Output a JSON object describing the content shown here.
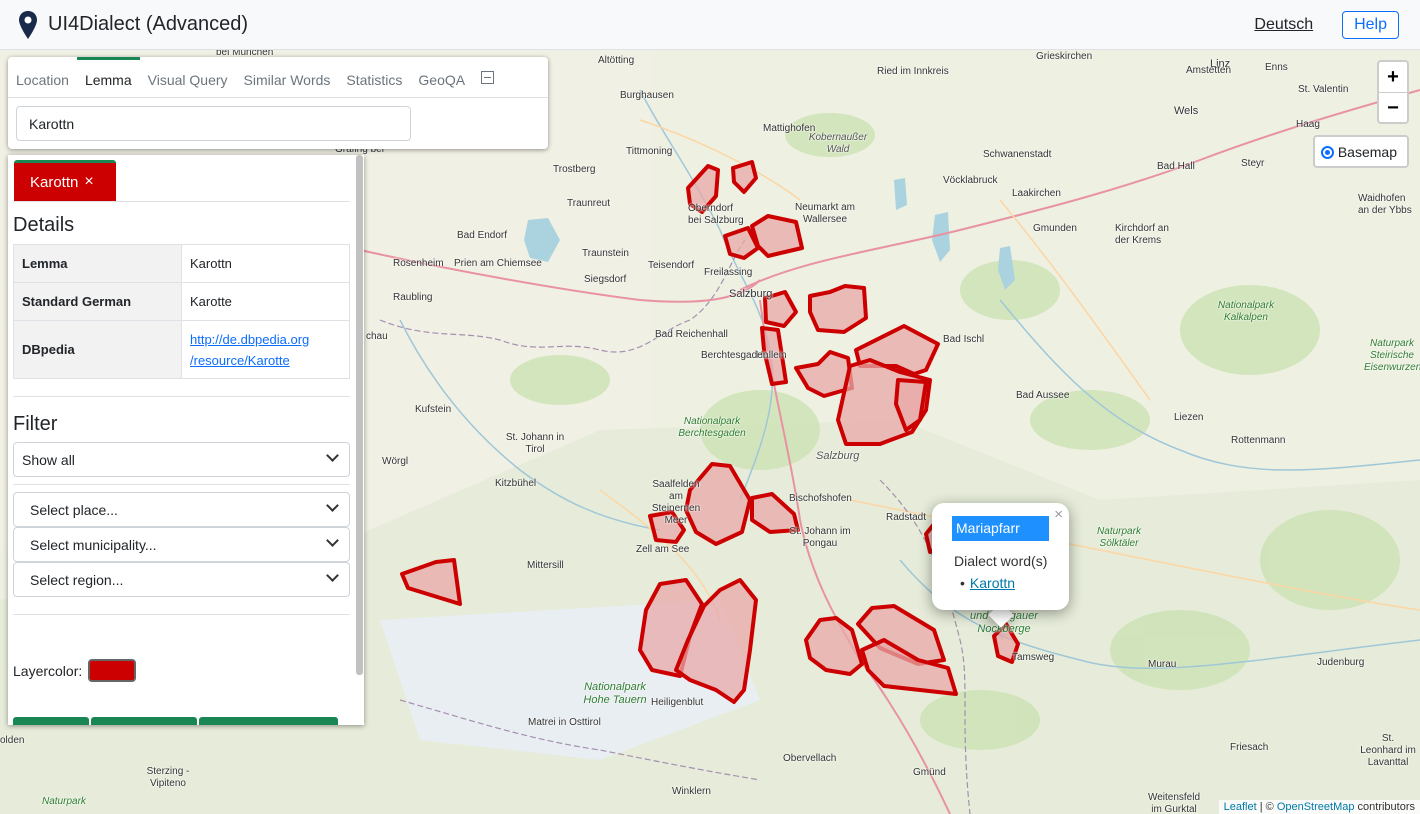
{
  "app": {
    "title": "UI4Dialect (Advanced)"
  },
  "nav": {
    "language_link": "Deutsch",
    "help_button": "Help"
  },
  "tabs": [
    {
      "label": "Location",
      "active": false
    },
    {
      "label": "Lemma",
      "active": true
    },
    {
      "label": "Visual Query",
      "active": false
    },
    {
      "label": "Similar Words",
      "active": false
    },
    {
      "label": "Statistics",
      "active": false
    },
    {
      "label": "GeoQA",
      "active": false
    }
  ],
  "search": {
    "value": "Karottn"
  },
  "sidebar": {
    "chip_label": "Karottn",
    "chip_close": "×",
    "details_title": "Details",
    "details": [
      {
        "key": "Lemma",
        "value": "Karottn"
      },
      {
        "key": "Standard German",
        "value": "Karotte"
      },
      {
        "key": "DBpedia",
        "link_line1": "http://de.dbpedia.org",
        "link_line2": "/resource/Karotte"
      }
    ],
    "filter_title": "Filter",
    "filter_select": "Show all",
    "place_select": "Select place...",
    "municipality_select": "Select municipality...",
    "region_select": "Select region...",
    "layercolor_label": "Layercolor:",
    "layercolor": "#cc0000"
  },
  "map_controls": {
    "zoom_in": "+",
    "zoom_out": "−",
    "basemap_label": "Basemap",
    "attribution_leaflet": "Leaflet",
    "attribution_sep": " | © ",
    "attribution_osm": "OpenStreetMap",
    "attribution_tail": " contributors"
  },
  "popup": {
    "title": "Mariapfarr",
    "close": "×",
    "subtitle": "Dialect word(s)",
    "bullet": "•",
    "word": "Karottn"
  },
  "map_labels": [
    "bei München",
    "Altötting",
    "Grieskirchen",
    "Ried im Innkreis",
    "Linz",
    "Amstetten",
    "Enns",
    "St. Valentin",
    "Burghausen",
    "Mattighofen",
    "Kobernaußer Wald",
    "Wels",
    "Haag",
    "Tittmoning",
    "Schwanenstadt",
    "Bad Hall",
    "Steyr",
    "Traunreut",
    "Trostberg",
    "Vöcklabruck",
    "Laakirchen",
    "Waidhofen an der Ybbs",
    "Oberndorf bei Salzburg",
    "Neumarkt am Wallersee",
    "Gmunden",
    "Kirchdorf an der Krems",
    "Bad Endorf",
    "Traunstein",
    "Teisendorf",
    "Rosenheim",
    "Prien am Chiemsee",
    "Siegsdorf",
    "Freilassing",
    "Raubling",
    "Salzburg",
    "Nationalpark Kalkalpen",
    "Bad Reichenhall",
    "Bad Ischl",
    "Hallein",
    "Naturpark Steirische Eisenwurzen",
    "Berchtesgaden",
    "Bad Aussee",
    "Kufstein",
    "Nationalpark Berchtesgaden",
    "Liezen",
    "St. Johann in Tirol",
    "Rottenmann",
    "Wörgl",
    "Kitzbühel",
    "Saalfelden am Steinernen Meer",
    "Bischofshofen",
    "Radstadt",
    "St. Johann im Pongau",
    "Zell am See",
    "Naturpark Sölktäler",
    "Mittersill",
    "und Lungauer Nockberge",
    "Tamsweg",
    "Judenburg",
    "Murau",
    "Nationalpark Hohe Tauern",
    "Heiligenblut",
    "Matrei in Osttirol",
    "Obervellach",
    "Friesach",
    "St. Leonhard im Lavanttal",
    "Sterzing - Vipiteno",
    "Gmünd",
    "Winklern",
    "Weitensfeld im Gurktal",
    "Naturpark",
    "olden",
    "chau",
    "Grafing bei"
  ]
}
